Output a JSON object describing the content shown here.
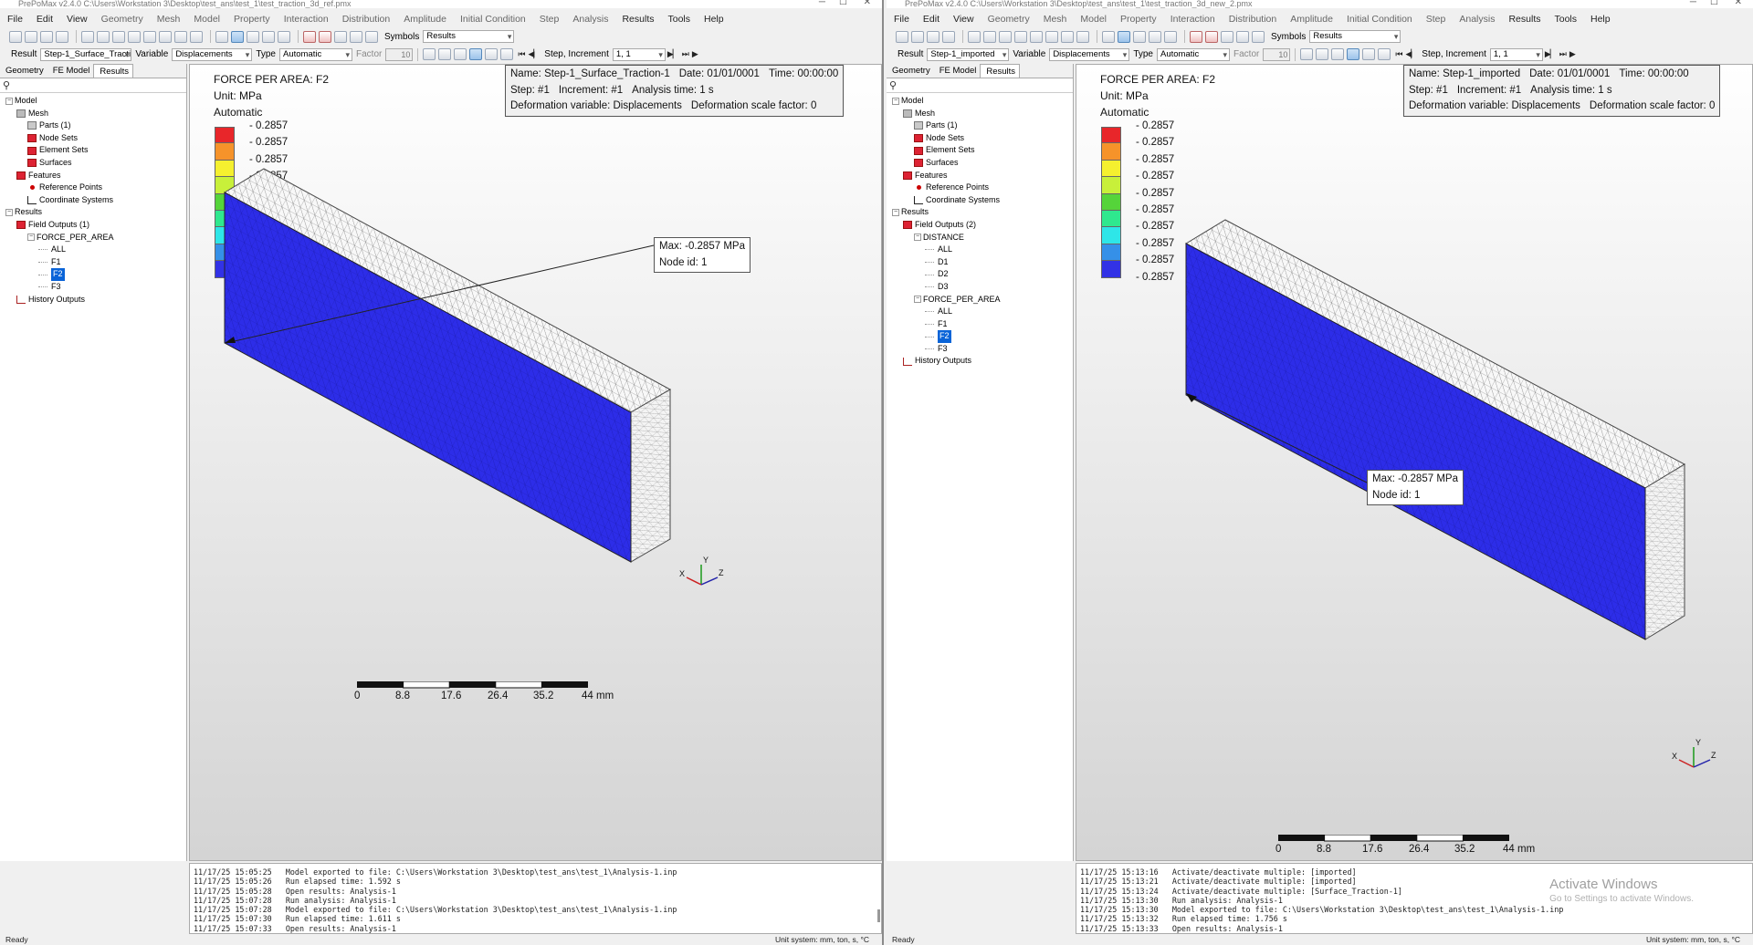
{
  "menu": [
    "File",
    "Edit",
    "View",
    "Geometry",
    "Mesh",
    "Model",
    "Property",
    "Interaction",
    "Distribution",
    "Amplitude",
    "Initial Condition",
    "Step",
    "Analysis",
    "Results",
    "Tools",
    "Help"
  ],
  "labels": {
    "symbols": "Symbols",
    "result": "Result",
    "variable": "Variable",
    "type": "Type",
    "factor": "Factor",
    "step_increment": "Step, Increment",
    "tab_geometry": "Geometry",
    "tab_fe_model": "FE Model",
    "tab_results": "Results",
    "ready": "Ready",
    "unit_system": "Unit system: mm, ton, s, °C"
  },
  "legend_colors": [
    "#e8262a",
    "#f6932a",
    "#f5f02f",
    "#c8f03a",
    "#55d43a",
    "#2fe88e",
    "#2ee6e8",
    "#3590e8",
    "#3232e6"
  ],
  "left": {
    "title": "PrePoMax v2.4.0   C:\\Users\\Workstation 3\\Desktop\\test_ans\\test_1\\test_traction_3d_ref.pmx",
    "symbols_value": "Results",
    "result_value": "Step-1_Surface_Traction-1",
    "variable_value": "Displacements",
    "type_value": "Automatic",
    "factor_value": "10",
    "increment_value": "1, 1",
    "tree": [
      {
        "level": 0,
        "icon": "exp",
        "label": "Model"
      },
      {
        "level": 1,
        "icon": "mesh",
        "label": "Mesh"
      },
      {
        "level": 2,
        "icon": "part",
        "label": "Parts (1)"
      },
      {
        "level": 2,
        "icon": "red",
        "label": "Node Sets"
      },
      {
        "level": 2,
        "icon": "red",
        "label": "Element Sets"
      },
      {
        "level": 2,
        "icon": "red",
        "label": "Surfaces"
      },
      {
        "level": 1,
        "icon": "red",
        "label": "Features"
      },
      {
        "level": 2,
        "icon": "dot",
        "label": "Reference Points"
      },
      {
        "level": 2,
        "icon": "axes",
        "label": "Coordinate Systems"
      },
      {
        "level": 0,
        "icon": "exp",
        "label": "Results"
      },
      {
        "level": 1,
        "icon": "red",
        "label": "Field Outputs (1)"
      },
      {
        "level": 2,
        "icon": "exp",
        "label": "FORCE_PER_AREA"
      },
      {
        "level": 3,
        "icon": "none",
        "label": "ALL"
      },
      {
        "level": 3,
        "icon": "none",
        "label": "F1"
      },
      {
        "level": 3,
        "icon": "none",
        "label": "F2",
        "selected": true
      },
      {
        "level": 3,
        "icon": "none",
        "label": "F3"
      },
      {
        "level": 1,
        "icon": "chart",
        "label": "History Outputs"
      }
    ],
    "field_title": "FORCE PER AREA: F2",
    "unit": "Unit: MPa",
    "mode": "Automatic",
    "legend_values": [
      "- 0.2857",
      "- 0.2857",
      "- 0.2857",
      "- 0.2857",
      "- 0.2857",
      "- 0.2857",
      "- 0.2857",
      "- 0.2857",
      "- 0.2857",
      "- 0.2857"
    ],
    "info": {
      "name": "Name: Step-1_Surface_Traction-1",
      "date": "Date: 01/01/0001",
      "time": "Time: 00:00:00",
      "step": "Step: #1",
      "increment": "Increment: #1",
      "analysis_time": "Analysis time: 1 s",
      "deformation_var": "Deformation variable: Displacements",
      "scale_factor": "Deformation scale factor: 0"
    },
    "callout": {
      "max": "Max: -0.2857 MPa",
      "node": "Node id: 1"
    },
    "scale_labels": [
      "0",
      "8.8",
      "17.6",
      "26.4",
      "35.2",
      "44 mm"
    ],
    "console": [
      "11/17/25 15:05:25   Model exported to file: C:\\Users\\Workstation 3\\Desktop\\test_ans\\test_1\\Analysis-1.inp",
      "11/17/25 15:05:26   Run elapsed time: 1.592 s",
      "11/17/25 15:05:28   Open results: Analysis-1",
      "11/17/25 15:07:28   Run analysis: Analysis-1",
      "11/17/25 15:07:28   Model exported to file: C:\\Users\\Workstation 3\\Desktop\\test_ans\\test_1\\Analysis-1.inp",
      "11/17/25 15:07:30   Run elapsed time: 1.611 s",
      "11/17/25 15:07:33   Open results: Analysis-1"
    ]
  },
  "right": {
    "title": "PrePoMax v2.4.0   C:\\Users\\Workstation 3\\Desktop\\test_ans\\test_1\\test_traction_3d_new_2.pmx",
    "symbols_value": "Results",
    "result_value": "Step-1_imported",
    "variable_value": "Displacements",
    "type_value": "Automatic",
    "factor_value": "10",
    "increment_value": "1, 1",
    "tree": [
      {
        "level": 0,
        "icon": "exp",
        "label": "Model"
      },
      {
        "level": 1,
        "icon": "mesh",
        "label": "Mesh"
      },
      {
        "level": 2,
        "icon": "part",
        "label": "Parts (1)"
      },
      {
        "level": 2,
        "icon": "red",
        "label": "Node Sets"
      },
      {
        "level": 2,
        "icon": "red",
        "label": "Element Sets"
      },
      {
        "level": 2,
        "icon": "red",
        "label": "Surfaces"
      },
      {
        "level": 1,
        "icon": "red",
        "label": "Features"
      },
      {
        "level": 2,
        "icon": "dot",
        "label": "Reference Points"
      },
      {
        "level": 2,
        "icon": "axes",
        "label": "Coordinate Systems"
      },
      {
        "level": 0,
        "icon": "exp",
        "label": "Results"
      },
      {
        "level": 1,
        "icon": "red",
        "label": "Field Outputs (2)"
      },
      {
        "level": 2,
        "icon": "exp",
        "label": "DISTANCE"
      },
      {
        "level": 3,
        "icon": "none",
        "label": "ALL"
      },
      {
        "level": 3,
        "icon": "none",
        "label": "D1"
      },
      {
        "level": 3,
        "icon": "none",
        "label": "D2"
      },
      {
        "level": 3,
        "icon": "none",
        "label": "D3"
      },
      {
        "level": 2,
        "icon": "exp",
        "label": "FORCE_PER_AREA"
      },
      {
        "level": 3,
        "icon": "none",
        "label": "ALL"
      },
      {
        "level": 3,
        "icon": "none",
        "label": "F1"
      },
      {
        "level": 3,
        "icon": "none",
        "label": "F2",
        "selected": true
      },
      {
        "level": 3,
        "icon": "none",
        "label": "F3"
      },
      {
        "level": 1,
        "icon": "chart",
        "label": "History Outputs"
      }
    ],
    "field_title": "FORCE PER AREA: F2",
    "unit": "Unit: MPa",
    "mode": "Automatic",
    "legend_values": [
      "- 0.2857",
      "- 0.2857",
      "- 0.2857",
      "- 0.2857",
      "- 0.2857",
      "- 0.2857",
      "- 0.2857",
      "- 0.2857",
      "- 0.2857",
      "- 0.2857"
    ],
    "info": {
      "name": "Name: Step-1_imported",
      "date": "Date: 01/01/0001",
      "time": "Time: 00:00:00",
      "step": "Step: #1",
      "increment": "Increment: #1",
      "analysis_time": "Analysis time: 1 s",
      "deformation_var": "Deformation variable: Displacements",
      "scale_factor": "Deformation scale factor: 0"
    },
    "callout": {
      "max": "Max: -0.2857 MPa",
      "node": "Node id: 1"
    },
    "scale_labels": [
      "0",
      "8.8",
      "17.6",
      "26.4",
      "35.2",
      "44 mm"
    ],
    "console": [
      "11/17/25 15:13:16   Activate/deactivate multiple: [imported]",
      "11/17/25 15:13:21   Activate/deactivate multiple: [imported]",
      "11/17/25 15:13:24   Activate/deactivate multiple: [Surface_Traction-1]",
      "11/17/25 15:13:30   Run analysis: Analysis-1",
      "11/17/25 15:13:30   Model exported to file: C:\\Users\\Workstation 3\\Desktop\\test_ans\\test_1\\Analysis-1.inp",
      "11/17/25 15:13:32   Run elapsed time: 1.756 s",
      "11/17/25 15:13:33   Open results: Analysis-1"
    ],
    "watermark_title": "Activate Windows",
    "watermark_sub": "Go to Settings to activate Windows."
  }
}
